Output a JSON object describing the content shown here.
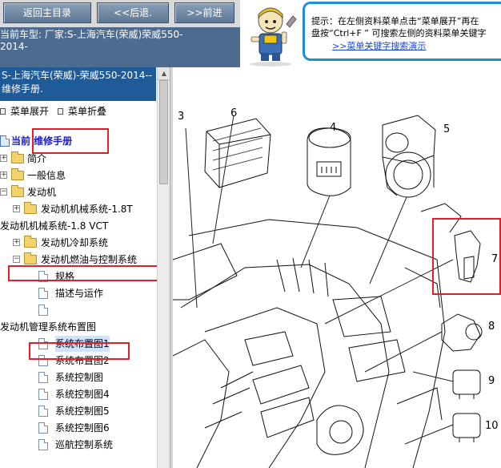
{
  "nav": {
    "home_label": "返回主目录",
    "back_label": "<<后退.",
    "forward_label": ">>前进"
  },
  "car_info": {
    "text": "当前车型:  厂家:S-上海汽车(荣威)荣威550-2014-"
  },
  "tip": {
    "line1": "提示：在左侧资料菜单点击“菜单展开”再在",
    "line2": "盘按“Ctrl+F ” 可搜索左侧的资料菜单关键字",
    "link": ">>菜单关键字搜索演示"
  },
  "left_panel": {
    "manual_title": "S-上海汽车(荣威)-荣威550-2014-- 维修手册.",
    "expand_label": "菜单展开",
    "collapse_label": "菜单折叠"
  },
  "tree": {
    "root": "当前 维修手册",
    "items": [
      "简介",
      "一般信息",
      "发动机",
      "发动机机械系统-1.8T",
      "发动机机械系统-1.8 VCT",
      "发动机冷却系统",
      "发动机燃油与控制系统",
      "规格",
      "描述与运作",
      "发动机管理系统布置图",
      "系统布置图1",
      "系统布置图2",
      "系统控制图",
      "系统控制图4",
      "系统控制图5",
      "系统控制图6",
      "巡航控制系统"
    ]
  },
  "diagram": {
    "callouts": [
      "3",
      "6",
      "4",
      "5",
      "7",
      "8",
      "9",
      "10"
    ]
  },
  "colors": {
    "title_blue": "#1f5a99",
    "car_bar": "#4d6b8f",
    "tip_border": "#1a8fd8",
    "highlight_red": "#e0202a"
  }
}
